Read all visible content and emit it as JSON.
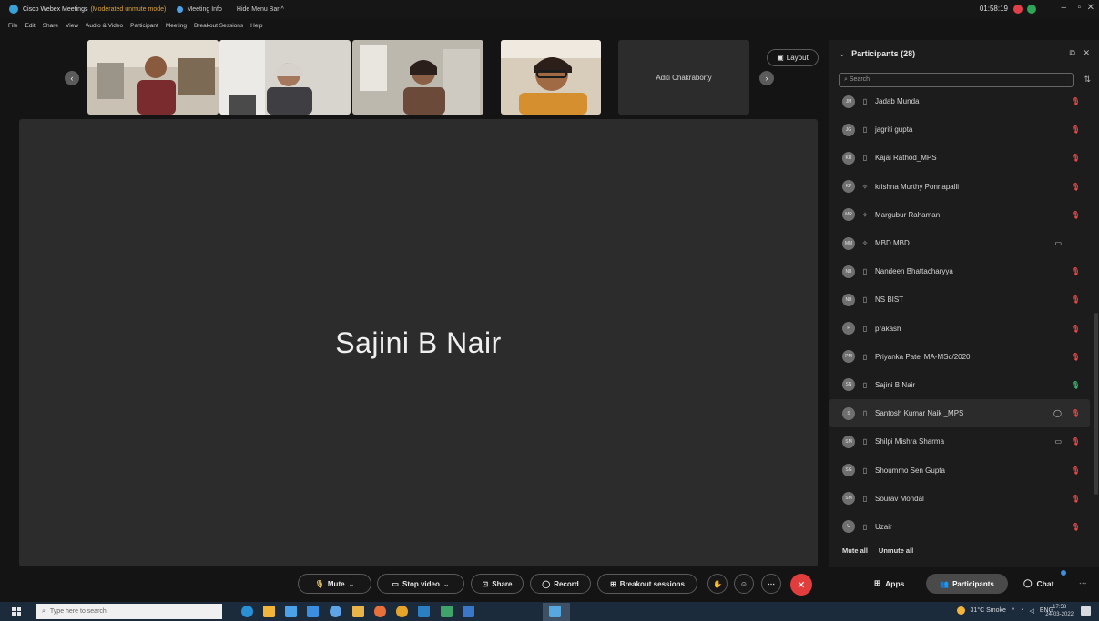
{
  "titlebar": {
    "title": "Cisco Webex Meetings",
    "mode": "(Moderated unmute mode)",
    "meeting_info": "Meeting Info",
    "hide_menu_bar": "Hide Menu Bar ^",
    "clock": "01:58:19"
  },
  "menubar": [
    "File",
    "Edit",
    "Share",
    "View",
    "Audio & Video",
    "Participant",
    "Meeting",
    "Breakout Sessions",
    "Help"
  ],
  "thumbnails": {
    "name_tile": "Aditi Chakraborty",
    "layout_label": "Layout"
  },
  "stage": {
    "active_name": "Sajini B Nair"
  },
  "panel": {
    "title": "Participants (28)",
    "search_placeholder": "Search",
    "participants": [
      {
        "initials": "JM",
        "name": "Jadab Munda",
        "device": "phone",
        "mic": "muted",
        "chat": ""
      },
      {
        "initials": "JG",
        "name": "jagriti gupta",
        "device": "phone",
        "mic": "muted",
        "chat": ""
      },
      {
        "initials": "KR",
        "name": "Kajal Rathod_MPS",
        "device": "phone",
        "mic": "muted",
        "chat": ""
      },
      {
        "initials": "KP",
        "name": "krishna Murthy Ponnapalli",
        "device": "desktop",
        "mic": "muted",
        "chat": ""
      },
      {
        "initials": "MR",
        "name": "Margubur Rahaman",
        "device": "desktop",
        "mic": "muted",
        "chat": ""
      },
      {
        "initials": "MM",
        "name": "MBD MBD",
        "device": "desktop",
        "mic": "",
        "chat": "video"
      },
      {
        "initials": "NB",
        "name": "Nandeen Bhattacharyya",
        "device": "phone",
        "mic": "muted",
        "chat": ""
      },
      {
        "initials": "NB",
        "name": "NS BIST",
        "device": "phone",
        "mic": "muted",
        "chat": ""
      },
      {
        "initials": "P",
        "name": "prakash",
        "device": "phone",
        "mic": "muted",
        "chat": ""
      },
      {
        "initials": "PM",
        "name": "Priyanka Patel MA-MSc/2020",
        "device": "phone",
        "mic": "muted",
        "chat": ""
      },
      {
        "initials": "SN",
        "name": "Sajini B Nair",
        "device": "phone",
        "mic": "on",
        "chat": ""
      },
      {
        "initials": "S",
        "name": "Santosh Kumar Naik _MPS",
        "device": "phone",
        "mic": "muted",
        "chat": "chat",
        "highlight": true
      },
      {
        "initials": "SM",
        "name": "Shilpi Mishra Sharma",
        "device": "phone",
        "mic": "muted",
        "chat": "video"
      },
      {
        "initials": "SG",
        "name": "Shoummo Sen Gupta",
        "device": "phone",
        "mic": "muted",
        "chat": ""
      },
      {
        "initials": "SM",
        "name": "Sourav Mondal",
        "device": "phone",
        "mic": "muted",
        "chat": ""
      },
      {
        "initials": "U",
        "name": "Uzair",
        "device": "phone",
        "mic": "muted",
        "chat": ""
      }
    ],
    "mute_all": "Mute all",
    "unmute_all": "Unmute all"
  },
  "controls": {
    "mute": "Mute",
    "stop_video": "Stop video",
    "share": "Share",
    "record": "Record",
    "breakout": "Breakout sessions",
    "apps": "Apps",
    "participants": "Participants",
    "chat": "Chat"
  },
  "taskbar": {
    "search_placeholder": "Type here to search",
    "weather": "31°C Smoke",
    "lang": "ENG",
    "time": "17:58",
    "date": "24-03-2022"
  },
  "colors": {
    "mic_muted": "#e04a4a",
    "mic_on": "#3bb36a",
    "end_call": "#e23d3d",
    "recording": "#e1404a"
  }
}
